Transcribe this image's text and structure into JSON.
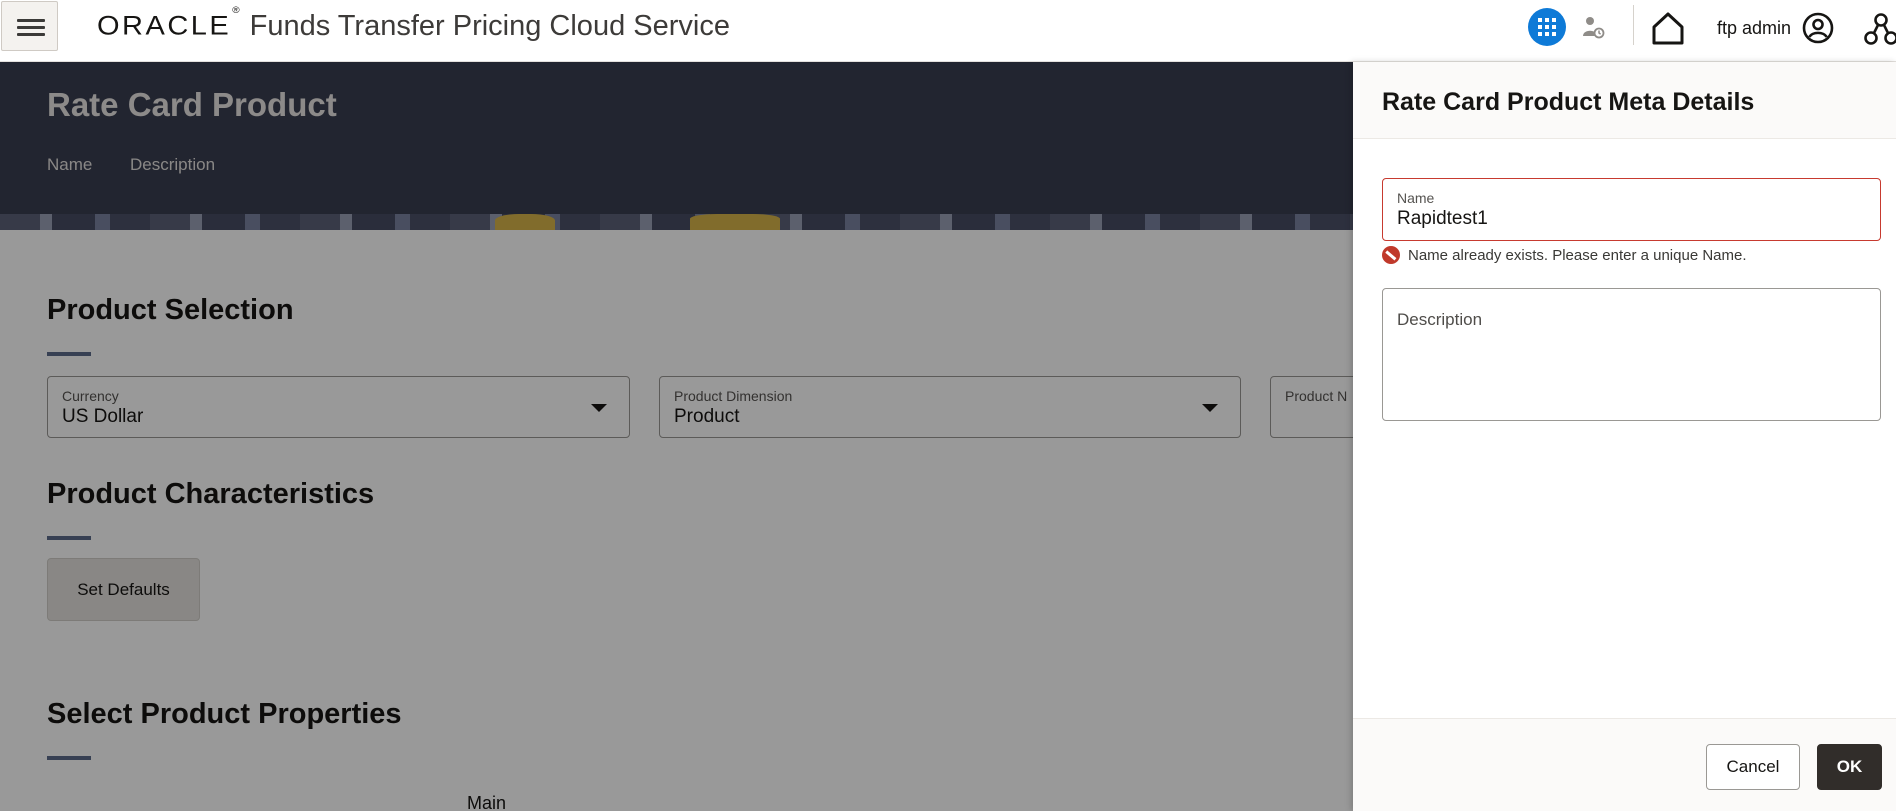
{
  "header": {
    "brand_logo": "ORACLE",
    "brand_registered": "®",
    "app_title": "Funds Transfer Pricing Cloud Service",
    "user_name": "ftp admin",
    "icons": [
      "hamburger-icon",
      "apps-grid-icon",
      "user-task-icon",
      "home-icon",
      "user-avatar-icon",
      "hierarchy-icon"
    ],
    "accent_color": "#0e7ad7"
  },
  "page": {
    "title": "Rate Card Product",
    "links": {
      "name": "Name",
      "description": "Description"
    },
    "product_selection": {
      "title": "Product Selection",
      "currency": {
        "label": "Currency",
        "value": "US Dollar"
      },
      "product_dimension": {
        "label": "Product Dimension",
        "value": "Product"
      },
      "product_name_partial_label": "Product N"
    },
    "product_characteristics": {
      "title": "Product Characteristics",
      "set_defaults_label": "Set Defaults"
    },
    "select_product_properties": {
      "title": "Select Product Properties",
      "main_label": "Main"
    }
  },
  "drawer": {
    "title": "Rate Card Product Meta Details",
    "name_field": {
      "label": "Name",
      "value": "Rapidtest1"
    },
    "name_error": "Name already exists. Please enter a unique Name.",
    "description_field": {
      "label": "Description",
      "value": ""
    },
    "cancel_label": "Cancel",
    "ok_label": "OK",
    "error_color": "#c73a2f"
  }
}
